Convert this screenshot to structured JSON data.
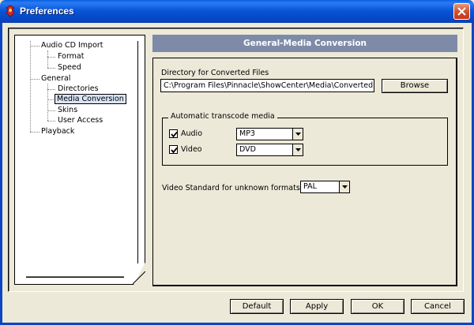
{
  "window": {
    "title": "Preferences"
  },
  "tree": {
    "audio_cd_import": "Audio CD Import",
    "format": "Format",
    "speed": "Speed",
    "general": "General",
    "directories": "Directories",
    "media_conversion": "Media Conversion",
    "skins": "Skins",
    "user_access": "User Access",
    "playback": "Playback"
  },
  "section": {
    "header": "General-Media Conversion",
    "directory_label": "Directory for Converted Files",
    "directory_value": "C:\\Program Files\\Pinnacle\\ShowCenter\\Media\\Converted",
    "browse_label": "Browse",
    "transcode_group_title": "Automatic transcode media",
    "audio_label": "Audio",
    "audio_checked": true,
    "audio_format": "MP3",
    "video_label": "Video",
    "video_checked": true,
    "video_format": "DVD",
    "video_standard_label": "Video Standard for unknown formats",
    "video_standard_value": "PAL"
  },
  "footer": {
    "default_label": "Default",
    "apply_label": "Apply",
    "ok_label": "OK",
    "cancel_label": "Cancel"
  },
  "colors": {
    "titlebar": "#0a5fe0",
    "header_bg": "#7e8ba8",
    "window_bg": "#ece9d8",
    "selected_bg": "#d9e4f7"
  }
}
